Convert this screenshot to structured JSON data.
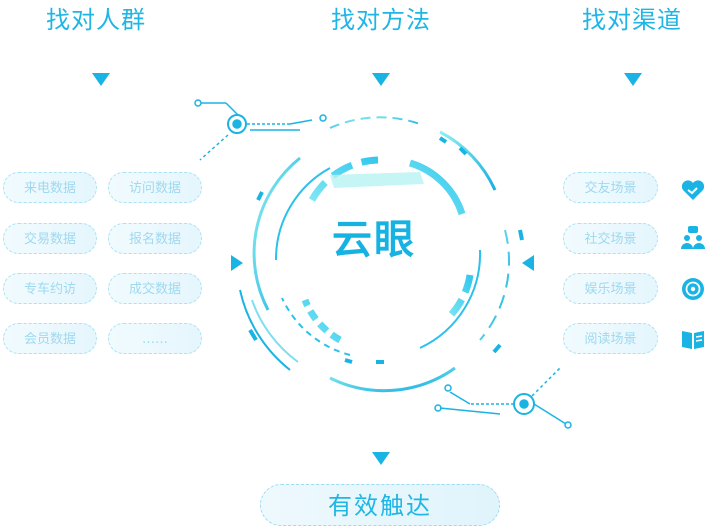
{
  "headings": {
    "left": "找对人群",
    "middle": "找对方法",
    "right": "找对渠道"
  },
  "left_items": [
    [
      "来电数据",
      "访问数据"
    ],
    [
      "交易数据",
      "报名数据"
    ],
    [
      "专车约访",
      "成交数据"
    ],
    [
      "会员数据",
      "……"
    ]
  ],
  "right_items": [
    {
      "label": "交友场景",
      "icon": "handshake-heart-icon"
    },
    {
      "label": "社交场景",
      "icon": "people-chat-icon"
    },
    {
      "label": "娱乐场景",
      "icon": "disc-icon"
    },
    {
      "label": "阅读场景",
      "icon": "book-icon"
    }
  ],
  "center": {
    "title": "云眼"
  },
  "bottom": {
    "label": "有效触达"
  },
  "colors": {
    "accent": "#1ab4e4",
    "ring_light": "#8fe8f0",
    "pill_text": "#9fd9ef"
  }
}
